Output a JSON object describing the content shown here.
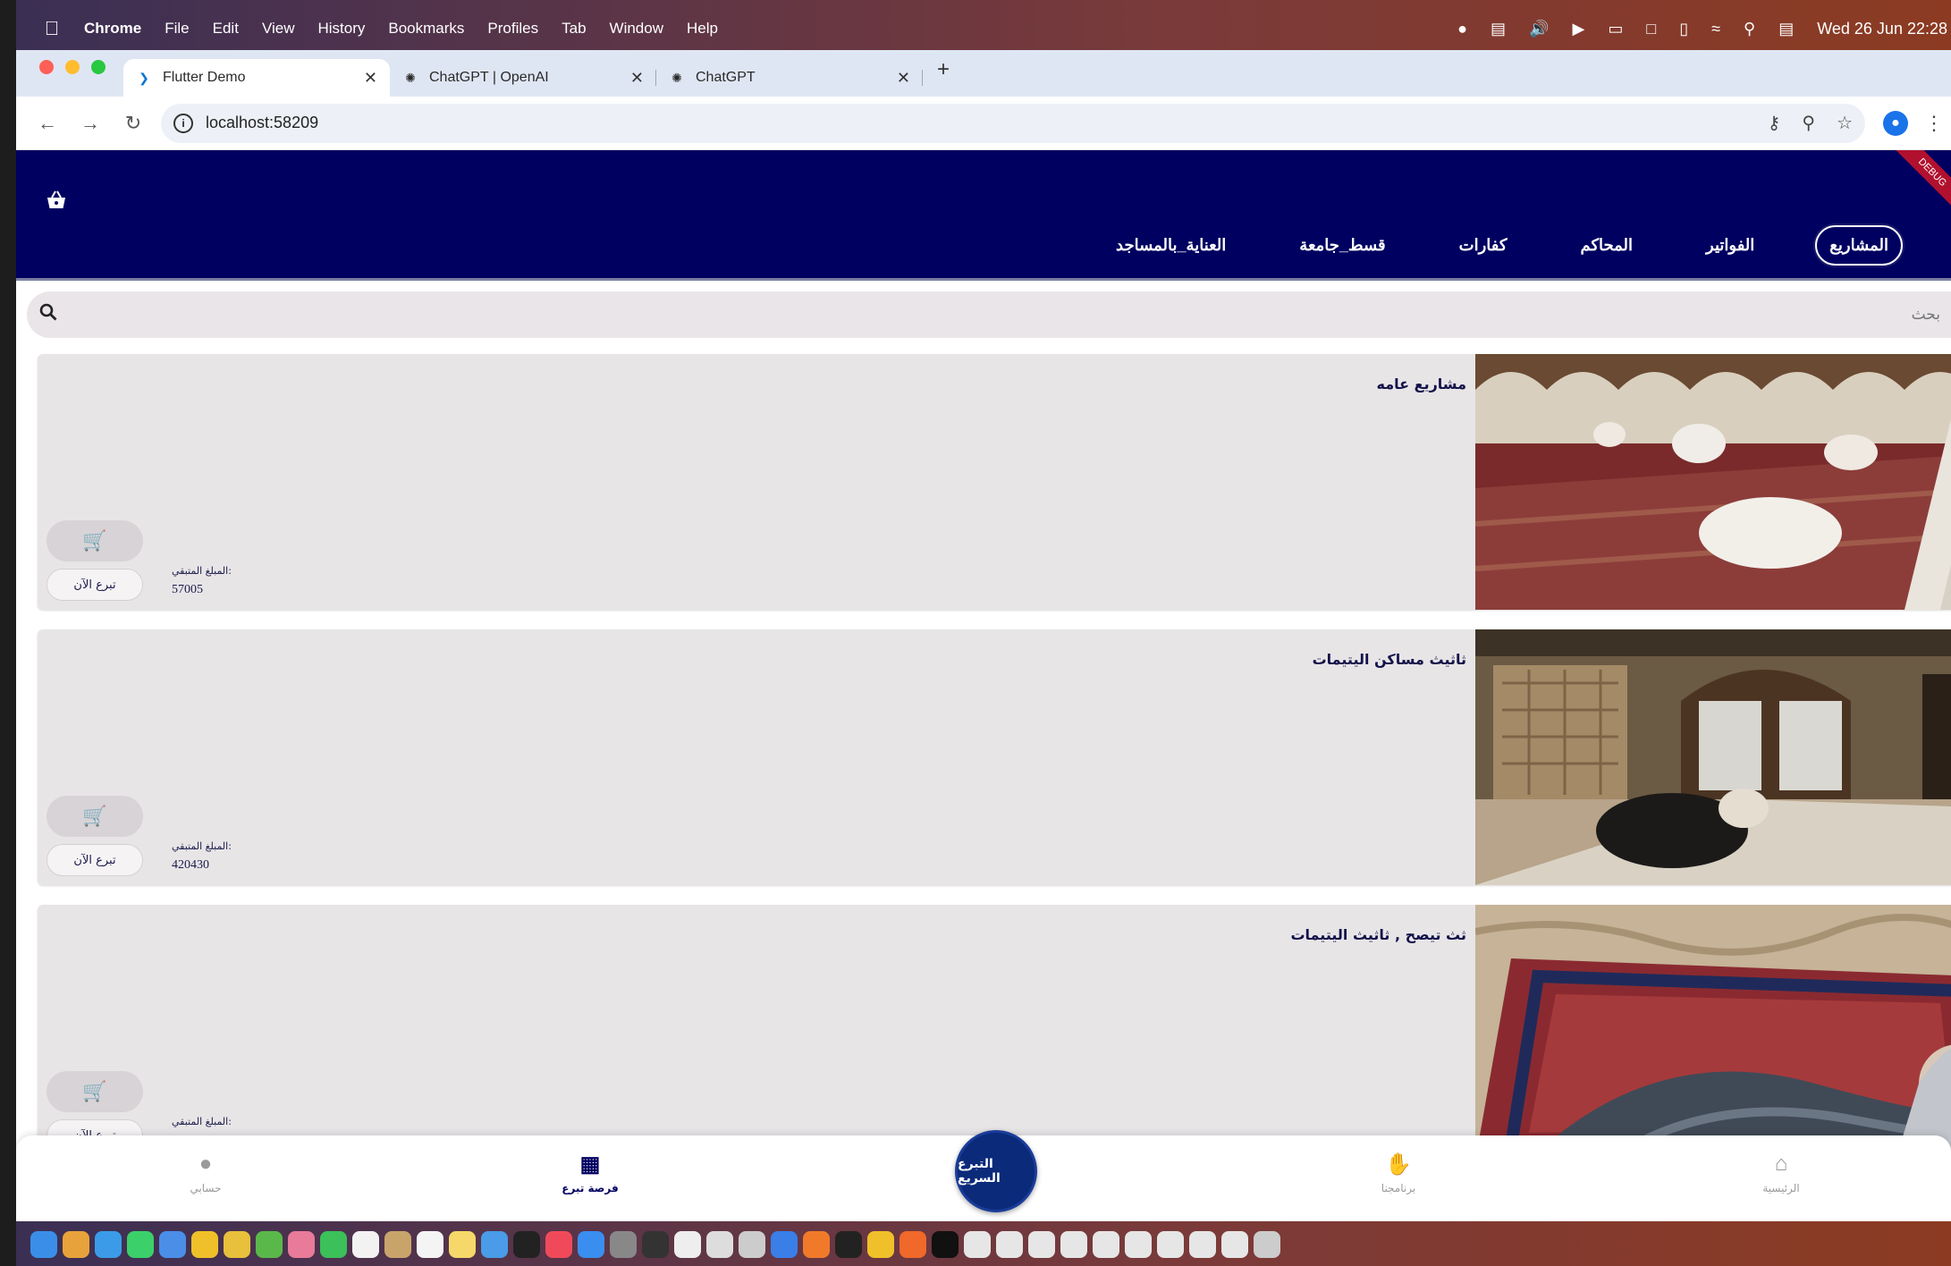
{
  "menubar": {
    "app": "Chrome",
    "items": [
      "File",
      "Edit",
      "View",
      "History",
      "Bookmarks",
      "Profiles",
      "Tab",
      "Window",
      "Help"
    ],
    "clock": "Wed 26 Jun  22:28"
  },
  "tabs": [
    {
      "title": "Flutter Demo",
      "icon": "flutter-icon"
    },
    {
      "title": "ChatGPT | OpenAI",
      "icon": "openai-icon"
    },
    {
      "title": "ChatGPT",
      "icon": "chatgpt-icon"
    }
  ],
  "address": {
    "url": "localhost:58209"
  },
  "app": {
    "debug_banner": "DEBUG",
    "categories": [
      "المشاريع",
      "الفواتير",
      "المحاكم",
      "كفارات",
      "قسط_جامعة",
      "العناية_بالمساجد"
    ],
    "search_placeholder": "بحث",
    "remaining_label": "المبلغ المتبقي:",
    "donate_label": "تبرع الآن",
    "projects": [
      {
        "title": "مشاريع عامه",
        "amount": "57005"
      },
      {
        "title": "ثاثيث مساكن اليتيمات",
        "amount": "420430"
      },
      {
        "title": "ثث تيصح , ثاثيث اليتيمات",
        "amount": ""
      }
    ],
    "bottom_nav": {
      "account": "حسابي",
      "opportunity": "فرصة تبرع",
      "quick_donate": "التبرع السريع",
      "programs": "برنامجنا",
      "home": "الرئيسية"
    }
  },
  "colors": {
    "primary": "#000061",
    "card": "#e8e5e7",
    "fab": "#0b2a7a"
  }
}
